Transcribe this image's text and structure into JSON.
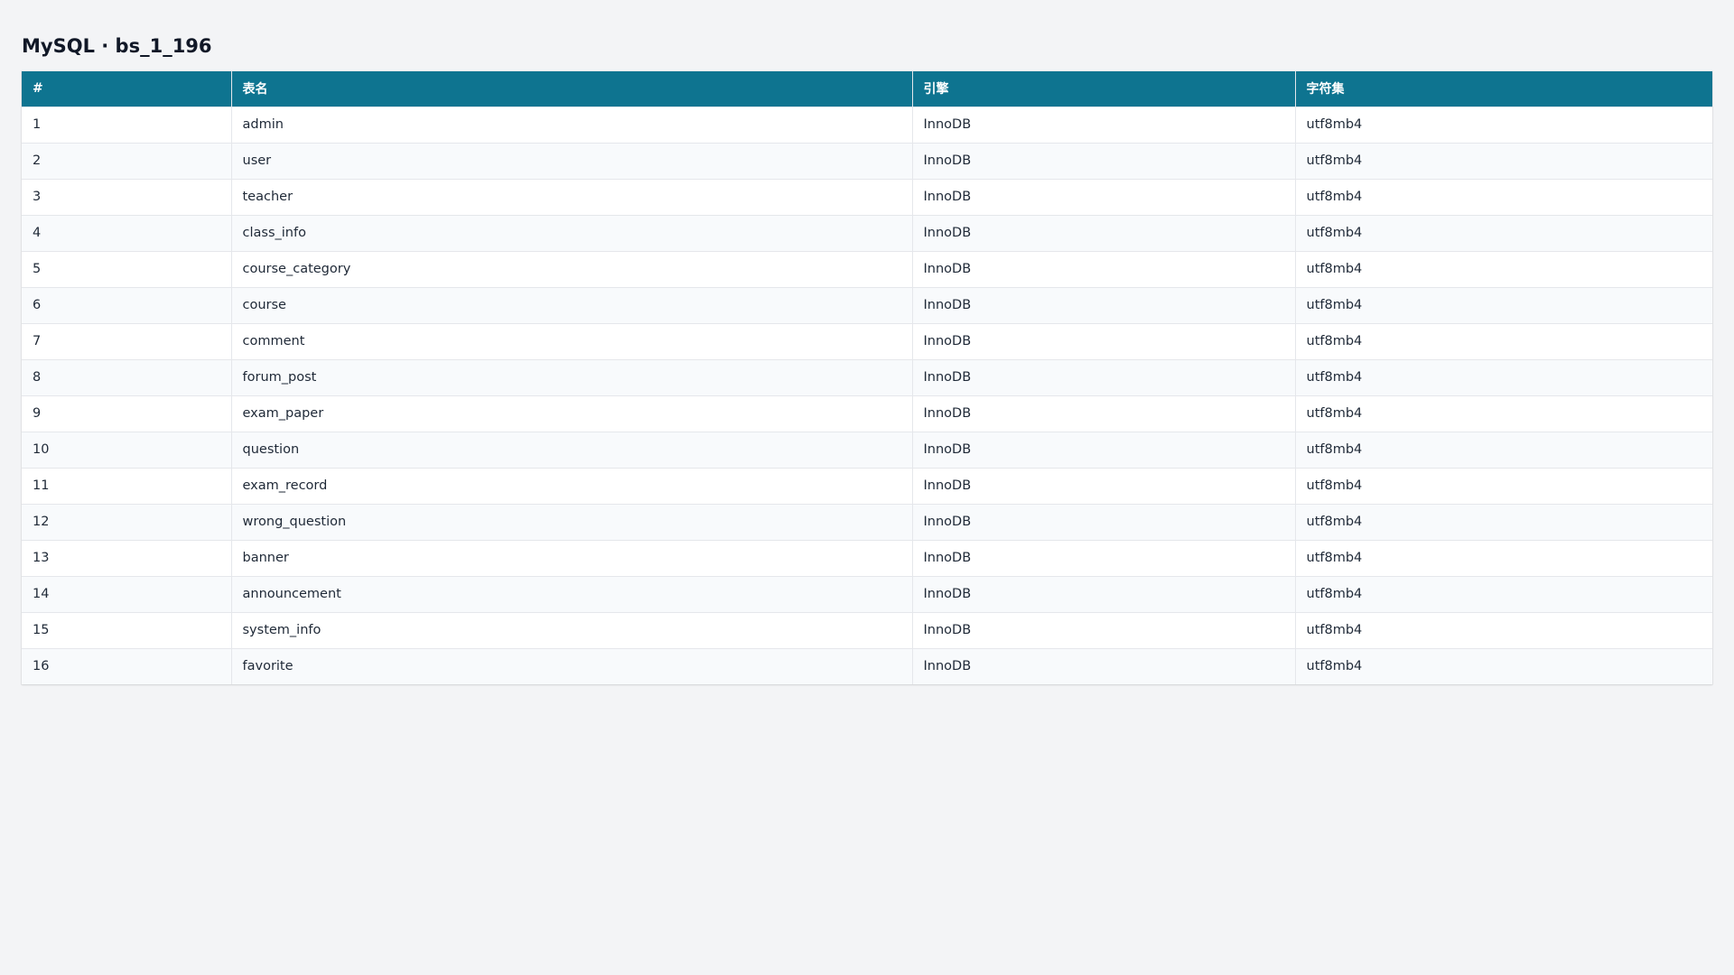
{
  "page": {
    "title": "MySQL · bs_1_196"
  },
  "table": {
    "headers": [
      "#",
      "表名",
      "引擎",
      "字符集"
    ],
    "rows": [
      [
        "1",
        "admin",
        "InnoDB",
        "utf8mb4"
      ],
      [
        "2",
        "user",
        "InnoDB",
        "utf8mb4"
      ],
      [
        "3",
        "teacher",
        "InnoDB",
        "utf8mb4"
      ],
      [
        "4",
        "class_info",
        "InnoDB",
        "utf8mb4"
      ],
      [
        "5",
        "course_category",
        "InnoDB",
        "utf8mb4"
      ],
      [
        "6",
        "course",
        "InnoDB",
        "utf8mb4"
      ],
      [
        "7",
        "comment",
        "InnoDB",
        "utf8mb4"
      ],
      [
        "8",
        "forum_post",
        "InnoDB",
        "utf8mb4"
      ],
      [
        "9",
        "exam_paper",
        "InnoDB",
        "utf8mb4"
      ],
      [
        "10",
        "question",
        "InnoDB",
        "utf8mb4"
      ],
      [
        "11",
        "exam_record",
        "InnoDB",
        "utf8mb4"
      ],
      [
        "12",
        "wrong_question",
        "InnoDB",
        "utf8mb4"
      ],
      [
        "13",
        "banner",
        "InnoDB",
        "utf8mb4"
      ],
      [
        "14",
        "announcement",
        "InnoDB",
        "utf8mb4"
      ],
      [
        "15",
        "system_info",
        "InnoDB",
        "utf8mb4"
      ],
      [
        "16",
        "favorite",
        "InnoDB",
        "utf8mb4"
      ]
    ]
  },
  "colors": {
    "header_bg": "#0e7490",
    "page_bg": "#f3f4f6"
  }
}
